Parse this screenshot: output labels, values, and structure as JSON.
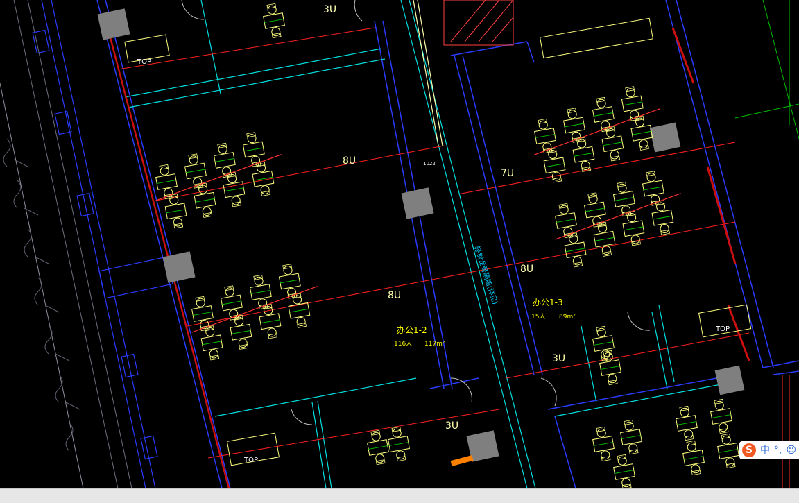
{
  "drawing": {
    "room_labels": [
      {
        "key": "r12",
        "name": "办公1-2",
        "info_people": "116人",
        "info_area": "117m²"
      },
      {
        "key": "r13",
        "name": "办公1-3",
        "info_people": "15人",
        "info_area": "89m²"
      }
    ],
    "circuit_labels": [
      "3U",
      "8U",
      "7U",
      "8U",
      "8U",
      "3U",
      "3U"
    ],
    "corridor_label": "轻钢龙骨隔墙(详见)",
    "door_tag": "1022",
    "top_tag": "TOP"
  },
  "ime_toolbar": {
    "logo": "S",
    "mode_label": "中",
    "punct_label": "°,",
    "extra_icon": "emoji-icon"
  },
  "colors": {
    "background": "#000000",
    "wall_blue": "#2a3cff",
    "furniture_yellow": "#ffff80",
    "line_red": "#ff2020",
    "line_cyan": "#00e0e0",
    "line_green": "#00ff00",
    "column_gray": "#808080"
  }
}
